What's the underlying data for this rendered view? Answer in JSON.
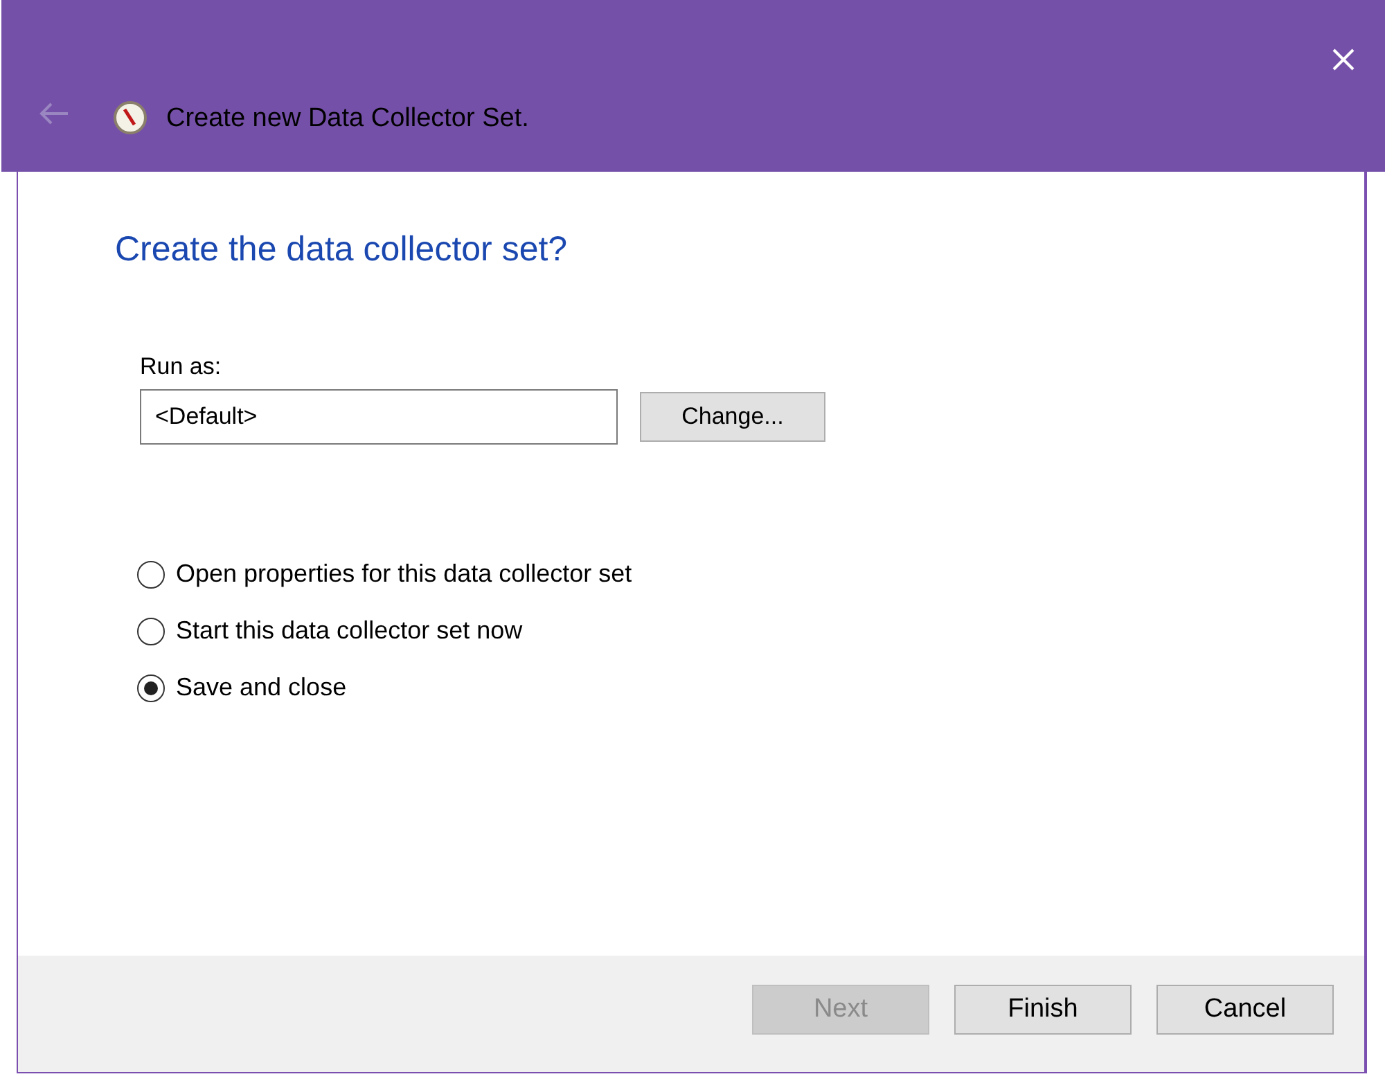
{
  "window": {
    "title": "Create new Data Collector Set.",
    "back_disabled": true
  },
  "heading": "Create the data collector set?",
  "run_as": {
    "label": "Run as:",
    "value": "<Default>",
    "button": "Change..."
  },
  "options": [
    {
      "label": "Open properties for this data collector set",
      "selected": false
    },
    {
      "label": "Start this data collector set now",
      "selected": false
    },
    {
      "label": "Save and close",
      "selected": true
    }
  ],
  "buttons": [
    {
      "label": "Next",
      "disabled": true
    },
    {
      "label": "Finish",
      "disabled": false
    },
    {
      "label": "Cancel",
      "disabled": false
    }
  ]
}
